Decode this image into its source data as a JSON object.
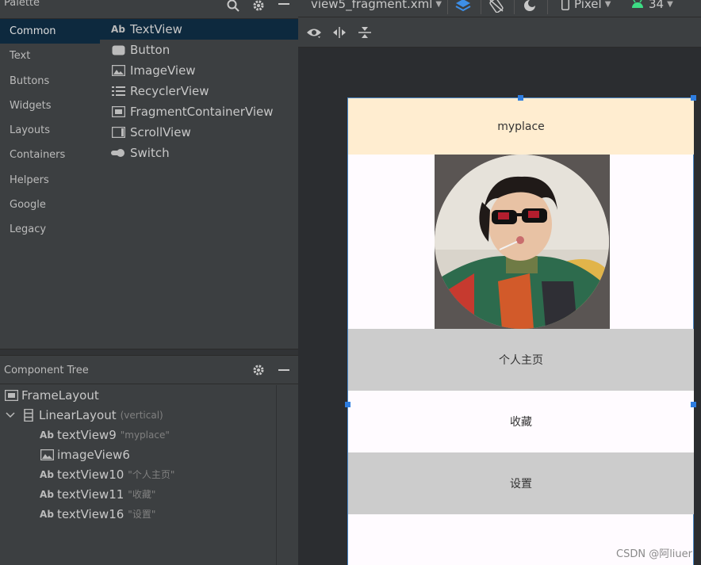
{
  "palette": {
    "title": "Palette",
    "categories": [
      "Common",
      "Text",
      "Buttons",
      "Widgets",
      "Layouts",
      "Containers",
      "Helpers",
      "Google",
      "Legacy"
    ],
    "selected_category": "Common",
    "widgets": [
      {
        "label": "TextView",
        "icon": "text-view-icon"
      },
      {
        "label": "Button",
        "icon": "button-icon"
      },
      {
        "label": "ImageView",
        "icon": "image-icon"
      },
      {
        "label": "RecyclerView",
        "icon": "list-icon"
      },
      {
        "label": "FragmentContainerView",
        "icon": "fragment-icon"
      },
      {
        "label": "ScrollView",
        "icon": "scroll-icon"
      },
      {
        "label": "Switch",
        "icon": "switch-icon"
      }
    ]
  },
  "tree": {
    "title": "Component Tree",
    "items": [
      {
        "label": "FrameLayout",
        "hint": ""
      },
      {
        "label": "LinearLayout",
        "hint": "(vertical)"
      },
      {
        "label": "textView9",
        "hint": "\"myplace\""
      },
      {
        "label": "imageView6",
        "hint": ""
      },
      {
        "label": "textView10",
        "hint": "\"个人主页\""
      },
      {
        "label": "textView11",
        "hint": "\"收藏\""
      },
      {
        "label": "textView16",
        "hint": "\"设置\""
      }
    ]
  },
  "toolbar": {
    "file": "view5_fragment.xml",
    "device": "Pixel",
    "api": "34"
  },
  "design": {
    "title_text": "myplace",
    "home_text": "个人主页",
    "favorites_text": "收藏",
    "settings_text": "设置"
  },
  "watermark": "CSDN @阿liuer",
  "colors": {
    "selection": "#0d293e",
    "accent": "#2e7de0",
    "title_band": "#ffedd0",
    "grey_band": "#cccccc",
    "android_green": "#3ddc84"
  }
}
